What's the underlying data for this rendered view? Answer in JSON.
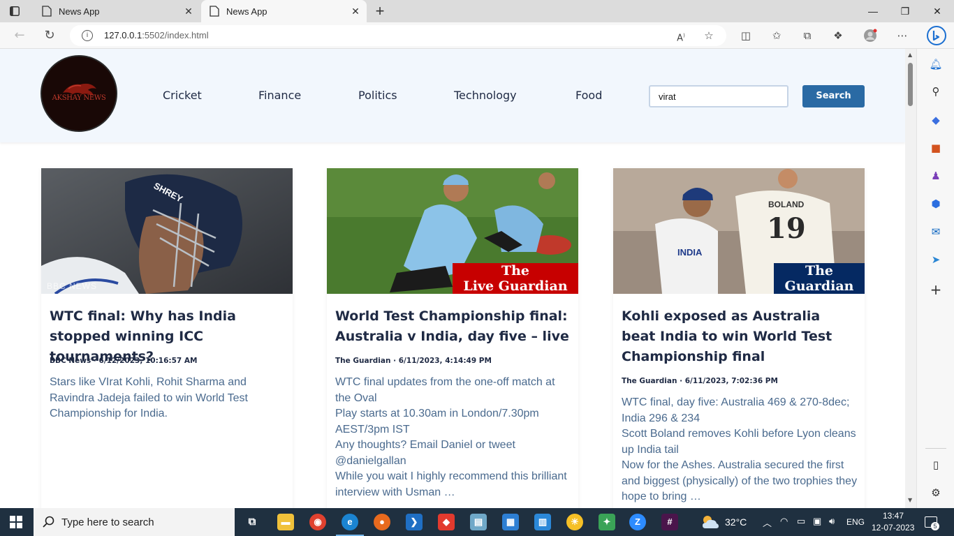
{
  "browser": {
    "tabs": [
      {
        "title": "News App",
        "active": false
      },
      {
        "title": "News App",
        "active": true
      }
    ],
    "url_host": "127.0.0.1",
    "url_rest": ":5502/index.html"
  },
  "site": {
    "logo_text": "AKSHAY NEWS",
    "nav": [
      "Cricket",
      "Finance",
      "Politics",
      "Technology",
      "Food"
    ],
    "search": {
      "value": "virat",
      "button": "Search"
    }
  },
  "articles": [
    {
      "title": "WTC final: Why has India stopped winning ICC tournaments?",
      "meta": "BBC News · 6/12/2023, 10:16:57 AM",
      "description": [
        "Stars like VIrat Kohli, Rohit Sharma and Ravindra Jadeja failed to win World Test Championship for India."
      ],
      "image_watermark": "BBC NEWS",
      "image_helmet_text": "SHREY"
    },
    {
      "title": "World Test Championship final: Australia v India, day five – live",
      "meta": "The Guardian · 6/11/2023, 4:14:49 PM",
      "description": [
        "WTC final updates from the one-off match at the Oval",
        "Play starts at 10.30am in London/7.30pm AEST/3pm IST",
        "Any thoughts? Email Daniel or tweet @danielgallan",
        "While you wait I highly recommend this brilliant interview with Usman …"
      ],
      "image_badge_line1": "The",
      "image_badge_line2": "Live Guardian"
    },
    {
      "title": "Kohli exposed as Australia beat India to win World Test Championship final",
      "meta": "The Guardian · 6/11/2023, 7:02:36 PM",
      "description": [
        "WTC final, day five: Australia 469 & 270-8dec; India 296 & 234",
        "Scott Boland removes Kohli before Lyon cleans up India tail",
        "Now for the Ashes. Australia secured the first and biggest (physically) of the two trophies they hope to bring …"
      ],
      "image_badge_line1": "The",
      "image_badge_line2": "Guardian",
      "image_jersey_india": "INDIA",
      "image_jersey_name": "BOLAND",
      "image_jersey_number": "19"
    }
  ],
  "taskbar": {
    "search_placeholder": "Type here to search",
    "weather": "32°C",
    "language": "ENG",
    "time": "13:47",
    "date": "12-07-2023",
    "notifications": "5"
  },
  "colors": {
    "header_bg": "#f2f7fd",
    "button_bg": "#2a6aa4",
    "title_text": "#1f2a44",
    "desc_text": "#4a6a8e",
    "guardian_red": "#c70000",
    "guardian_navy": "#052962"
  }
}
